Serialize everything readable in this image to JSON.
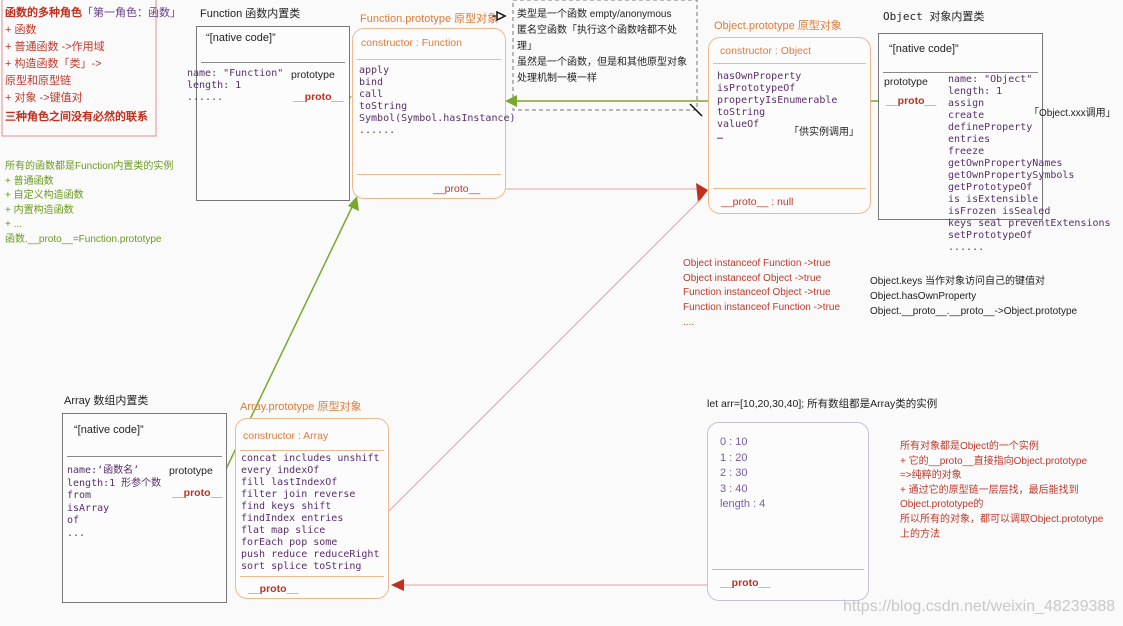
{
  "roles_note": {
    "title": "函数的多种角色",
    "title_suffix": "「第一角色：函数」",
    "lines": [
      "+ 函数",
      "  + 普通函数 ->作用域",
      "  + 构造函数「类」->",
      "原型和原型链",
      "+ 对象 ->键值对"
    ],
    "conclusion": "三种角色之间没有必然的联系"
  },
  "functions_note": {
    "lines": [
      "所有的函数都是Function内置类的实例",
      "+ 普通函数",
      "+ 自定义构造函数",
      "+ 内置构造函数",
      "+ ...",
      "函数.__proto__=Function.prototype"
    ]
  },
  "function_class": {
    "title": "Function 函数内置类",
    "native": "“[native code]”",
    "props": [
      "name: \"Function\"",
      "length: 1",
      "......"
    ],
    "prototype": "prototype",
    "proto": "__proto__"
  },
  "function_prototype": {
    "title": "Function.prototype 原型对象",
    "constructor": "constructor : Function",
    "methods": [
      "apply",
      "bind",
      "call",
      "toString",
      "Symbol(Symbol.hasInstance)",
      "......"
    ],
    "proto": "__proto__"
  },
  "anonymous_note": {
    "lines": [
      "类型是一个函数 empty/anonymous",
      "匿名空函数「执行这个函数啥都不处",
      "理」",
      "虽然是一个函数，但是和其他原型对象",
      "处理机制一模一样"
    ]
  },
  "object_prototype": {
    "title": "Object.prototype  原型对象",
    "constructor": "constructor : Object",
    "methods": [
      "hasOwnProperty",
      "isPrototypeOf",
      "propertyIsEnumerable",
      "toString",
      "valueOf",
      "…"
    ],
    "note": "「供实例调用」",
    "proto": "__proto__ : null"
  },
  "object_class": {
    "title": "Object  对象内置类",
    "native": "“[native code]”",
    "prototype": "prototype",
    "proto": "__proto__",
    "props": [
      "name: \"Object\"",
      "length: 1",
      "assign",
      "create",
      "defineProperty",
      "entries",
      "freeze",
      "getOwnPropertyNames",
      "getOwnPropertySymbols",
      "getPrototypeOf",
      "is  isExtensible",
      "isFrozen isSealed",
      "keys seal preventExtensions",
      "setPrototypeOf",
      "......"
    ],
    "note": "「Object.xxx调用」"
  },
  "instanceof_note": {
    "lines": [
      "Object instanceof Function ->true",
      "Object instanceof Object ->true",
      "Function instanceof Object ->true",
      "Function instanceof Function ->true",
      "...."
    ]
  },
  "keys_note": {
    "lines": [
      "Object.keys  当作对象访问自己的键值对",
      "Object.hasOwnProperty",
      "  Object.__proto__.__proto__->Object.prototype"
    ]
  },
  "array_class": {
    "title": "Array 数组内置类",
    "native": "“[native code]”",
    "props": [
      "name:‘函数名’",
      "length:1 形参个数",
      "from",
      "isArray",
      "of",
      "..."
    ],
    "prototype": "prototype",
    "proto": "__proto__"
  },
  "array_prototype": {
    "title": "Array.prototype 原型对象",
    "constructor": "constructor : Array",
    "methods": [
      "concat includes  unshift",
      "every  indexOf",
      "fill   lastIndexOf",
      "filter join  reverse",
      "find   keys  shift",
      "findIndex entries",
      "flat     map  slice",
      "forEach   pop  some",
      "push  reduce reduceRight",
      "sort splice toString"
    ],
    "proto": "__proto__"
  },
  "arr_instance": {
    "title": "let arr=[10,20,30,40];  所有数组都是Array类的实例",
    "items": [
      "0 : 10",
      "1 : 20",
      "2 : 30",
      "3 : 40",
      "length : 4"
    ],
    "proto": "__proto__"
  },
  "object_note": {
    "lines": [
      "所有对象都是Object的一个实例",
      "   + 它的__proto__直接指向Object.prototype",
      "=>纯粹的对象",
      "   + 通过它的原型链一层层找，最后能找到",
      "Object.prototype的",
      "所以所有的对象，都可以调取Object.prototype",
      "上的方法"
    ]
  },
  "watermark": "https://blog.csdn.net/weixin_48239388",
  "colors": {
    "green_arrow": "#7aa82a",
    "red_arrow": "#c0301f",
    "orange": "#e07b39",
    "purple": "#5a2d6b"
  }
}
